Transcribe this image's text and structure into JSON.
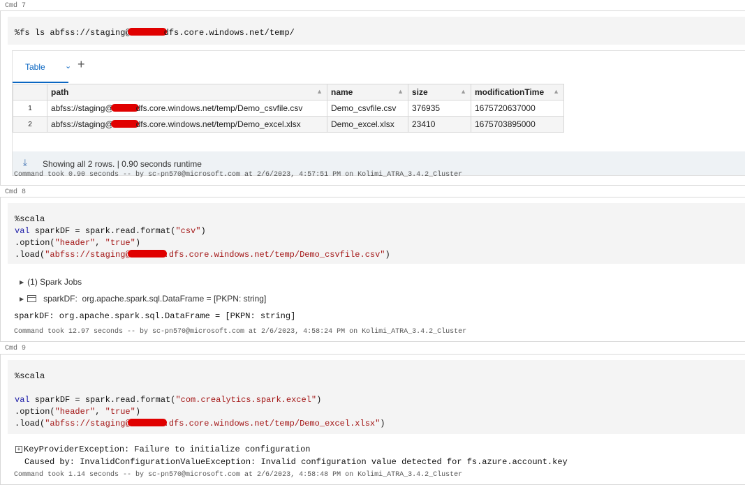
{
  "cmd7": {
    "label": "Cmd 7",
    "code_prefix": "%fs ls abfss://staging@",
    "code_suffix": "dfs.core.windows.net/temp/",
    "result": {
      "tab_label": "Table",
      "columns": [
        "path",
        "name",
        "size",
        "modificationTime"
      ],
      "rows": [
        {
          "num": "1",
          "path_prefix": "abfss://staging@",
          "path_suffix": "dfs.core.windows.net/temp/Demo_csvfile.csv",
          "name": "Demo_csvfile.csv",
          "size": "376935",
          "modificationTime": "1675720637000"
        },
        {
          "num": "2",
          "path_prefix": "abfss://staging@",
          "path_suffix": "dfs.core.windows.net/temp/Demo_excel.xlsx",
          "name": "Demo_excel.xlsx",
          "size": "23410",
          "modificationTime": "1675703895000"
        }
      ],
      "status": "Showing all 2 rows.  |  0.90 seconds runtime"
    },
    "footer": "Command took 0.90 seconds -- by sc-pn570@microsoft.com at 2/6/2023, 4:57:51 PM on Kolimi_ATRA_3.4.2_Cluster"
  },
  "cmd8": {
    "label": "Cmd 8",
    "line1": "%scala",
    "line2_kw": "val",
    "line2_a": " sparkDF = spark.read.format(",
    "line2_str": "\"csv\"",
    "line2_b": ")",
    "line3_a": ".option(",
    "line3_s1": "\"header\"",
    "line3_b": ", ",
    "line3_s2": "\"true\"",
    "line3_c": ")",
    "line4_a": ".load(",
    "line4_s1": "\"abfss://staging@",
    "line4_s2": ".dfs.core.windows.net/temp/Demo_csvfile.csv\"",
    "line4_b": ")",
    "spark_jobs": "(1) Spark Jobs",
    "df_name": "sparkDF:",
    "df_type": "org.apache.spark.sql.DataFrame = [PKPN: string]",
    "output": "sparkDF: org.apache.spark.sql.DataFrame = [PKPN: string]",
    "footer": "Command took 12.97 seconds -- by sc-pn570@microsoft.com at 2/6/2023, 4:58:24 PM on Kolimi_ATRA_3.4.2_Cluster"
  },
  "cmd9": {
    "label": "Cmd 9",
    "line1": "%scala",
    "line2_kw": "val",
    "line2_a": " sparkDF = spark.read.format(",
    "line2_str": "\"com.crealytics.spark.excel\"",
    "line2_b": ")",
    "line3_a": ".option(",
    "line3_s1": "\"header\"",
    "line3_b": ", ",
    "line3_s2": "\"true\"",
    "line3_c": ")",
    "line4_a": ".load(",
    "line4_s1": "\"abfss://staging@",
    "line4_s2": ".dfs.core.windows.net/temp/Demo_excel.xlsx\"",
    "line4_b": ")",
    "error1": "KeyProviderException: Failure to initialize configuration",
    "error2": "Caused by: InvalidConfigurationValueException: Invalid configuration value detected for fs.azure.account.key",
    "footer": "Command took 1.14 seconds -- by sc-pn570@microsoft.com at 2/6/2023, 4:58:48 PM on Kolimi_ATRA_3.4.2_Cluster"
  }
}
